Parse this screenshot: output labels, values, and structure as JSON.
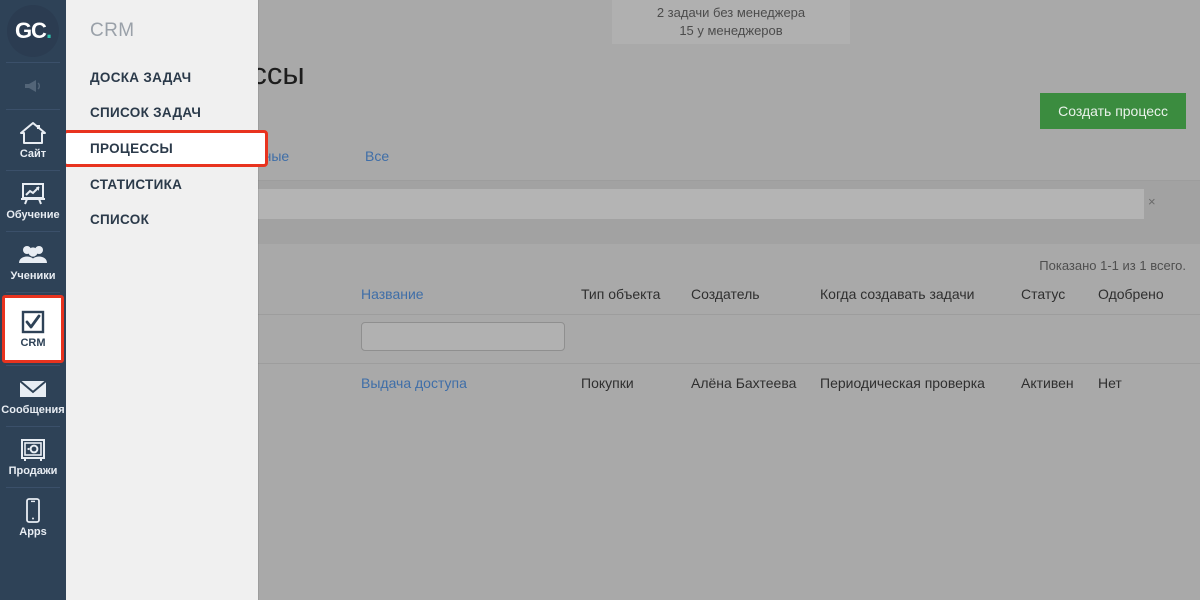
{
  "brand": {
    "logo_part1": "GC",
    "logo_part2": "."
  },
  "rail": {
    "items": [
      {
        "label": "",
        "icon": "megaphone-icon",
        "name": "announcements"
      },
      {
        "label": "Сайт",
        "icon": "home-icon",
        "name": "site"
      },
      {
        "label": "Обучение",
        "icon": "chart-board-icon",
        "name": "training"
      },
      {
        "label": "Ученики",
        "icon": "users-icon",
        "name": "students"
      },
      {
        "label": "CRM",
        "icon": "checkbox-check-icon",
        "name": "crm"
      },
      {
        "label": "Сообщения",
        "icon": "envelope-icon",
        "name": "messages"
      },
      {
        "label": "Продажи",
        "icon": "safe-icon",
        "name": "sales"
      },
      {
        "label": "Apps",
        "icon": "phone-icon",
        "name": "apps"
      }
    ]
  },
  "submenu": {
    "title": "CRM",
    "items": [
      {
        "label": "ДОСКА ЗАДАЧ",
        "name": "task-board"
      },
      {
        "label": "СПИСОК ЗАДАЧ",
        "name": "task-list"
      },
      {
        "label": "ПРОЦЕССЫ",
        "name": "processes"
      },
      {
        "label": "СТАТИСТИКА",
        "name": "statistics"
      },
      {
        "label": "СПИСОК",
        "name": "list"
      }
    ],
    "highlighted_index": 2
  },
  "banner": {
    "line1": "2 задачи без менеджера",
    "line2": "15 у менеджеров"
  },
  "header": {
    "title": "Процессы",
    "create_button": "Создать процесс"
  },
  "tabs": [
    {
      "label": "Неактивные",
      "name": "tab-inactive"
    },
    {
      "label": "Все",
      "name": "tab-all"
    }
  ],
  "search": {
    "value": "",
    "placeholder": "",
    "clear_icon": "×"
  },
  "pagination": {
    "showing": "Показано 1-1 из 1 всего."
  },
  "table": {
    "columns": [
      "Название",
      "Тип объекта",
      "Создатель",
      "Когда создавать задачи",
      "Статус",
      "Одобрено"
    ],
    "name_filter_value": "",
    "rows": [
      {
        "name": "Выдача доступа",
        "type": "Покупки",
        "creator": "Алёна Бахтеева",
        "when": "Периодическая проверка",
        "status": "Активен",
        "approved": "Нет"
      }
    ]
  },
  "colors": {
    "rail_bg": "#2e4257",
    "accent_teal": "#2ec4b0",
    "highlight_red": "#e8331f",
    "create_green": "#3b8c3f",
    "link_blue": "#3f6ea8"
  }
}
